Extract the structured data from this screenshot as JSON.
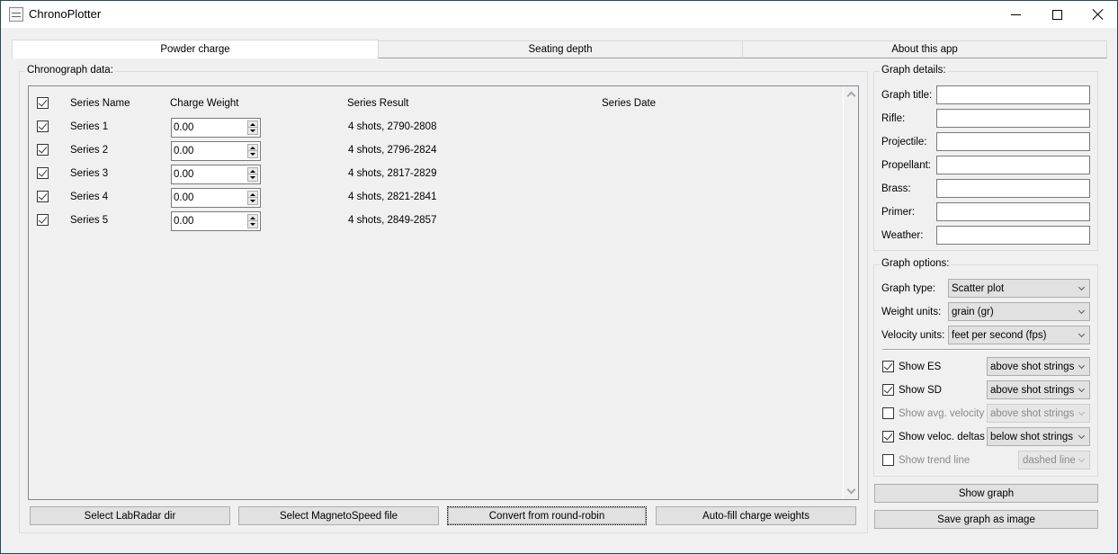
{
  "window": {
    "title": "ChronoPlotter",
    "icon": "app-icon"
  },
  "tabs": [
    {
      "label": "Powder charge",
      "active": true
    },
    {
      "label": "Seating depth",
      "active": false
    },
    {
      "label": "About this app",
      "active": false
    }
  ],
  "chronograph": {
    "group_label": "Chronograph data:",
    "columns": [
      "Series Name",
      "Charge Weight",
      "Series Result",
      "Series Date"
    ],
    "header_checked": true,
    "rows": [
      {
        "checked": true,
        "name": "Series 1",
        "charge_weight": "0.00",
        "result": "4 shots, 2790-2808",
        "date": ""
      },
      {
        "checked": true,
        "name": "Series 2",
        "charge_weight": "0.00",
        "result": "4 shots, 2796-2824",
        "date": ""
      },
      {
        "checked": true,
        "name": "Series 3",
        "charge_weight": "0.00",
        "result": "4 shots, 2817-2829",
        "date": ""
      },
      {
        "checked": true,
        "name": "Series 4",
        "charge_weight": "0.00",
        "result": "4 shots, 2821-2841",
        "date": ""
      },
      {
        "checked": true,
        "name": "Series 5",
        "charge_weight": "0.00",
        "result": "4 shots, 2849-2857",
        "date": ""
      }
    ],
    "buttons": {
      "labradar": "Select LabRadar dir",
      "magnetospeed": "Select MagnetoSpeed file",
      "round_robin": "Convert from round-robin",
      "autofill": "Auto-fill charge weights"
    }
  },
  "graph_details": {
    "group_label": "Graph details:",
    "fields": [
      {
        "label": "Graph title:",
        "value": ""
      },
      {
        "label": "Rifle:",
        "value": ""
      },
      {
        "label": "Projectile:",
        "value": ""
      },
      {
        "label": "Propellant:",
        "value": ""
      },
      {
        "label": "Brass:",
        "value": ""
      },
      {
        "label": "Primer:",
        "value": ""
      },
      {
        "label": "Weather:",
        "value": ""
      }
    ]
  },
  "graph_options": {
    "group_label": "Graph options:",
    "graph_type": {
      "label": "Graph type:",
      "value": "Scatter plot"
    },
    "weight_units": {
      "label": "Weight units:",
      "value": "grain (gr)"
    },
    "velocity_units": {
      "label": "Velocity units:",
      "value": "feet per second (fps)"
    },
    "toggles": [
      {
        "label": "Show ES",
        "checked": true,
        "enabled": true,
        "position": "above shot strings"
      },
      {
        "label": "Show SD",
        "checked": true,
        "enabled": true,
        "position": "above shot strings"
      },
      {
        "label": "Show avg. velocity",
        "checked": false,
        "enabled": false,
        "position": "above shot strings"
      },
      {
        "label": "Show veloc. deltas",
        "checked": true,
        "enabled": true,
        "position": "below shot strings"
      },
      {
        "label": "Show trend line",
        "checked": false,
        "enabled": false,
        "position": "dashed line"
      }
    ]
  },
  "actions": {
    "show_graph": "Show graph",
    "save_graph": "Save graph as image"
  }
}
